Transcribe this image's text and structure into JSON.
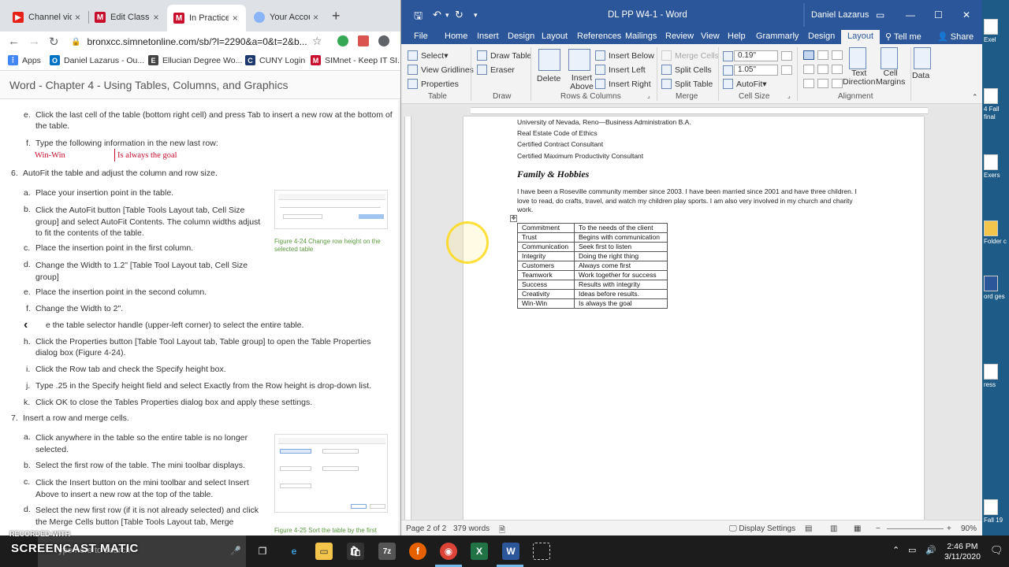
{
  "browser": {
    "tabs": [
      {
        "label": "Channel vid",
        "close": "×"
      },
      {
        "label": "Edit Class",
        "close": "×"
      },
      {
        "label": "In Practice",
        "close": "×"
      },
      {
        "label": "Your Accou",
        "close": "×"
      }
    ],
    "new_tab": "+",
    "url": "bronxcc.simnetonline.com/sb/?l=2290&a=0&t=2&b...",
    "bookmarks": [
      "Apps",
      "Daniel Lazarus - Ou...",
      "Ellucian Degree Wo...",
      "CUNY Login",
      "SIMnet - Keep IT SI..."
    ]
  },
  "simnet": {
    "title": "Word - Chapter 4 - Using Tables, Columns, and Graphics",
    "steps": [
      {
        "id": "e1",
        "letter": "e.",
        "text": "Click the last cell of the table (bottom right cell) and press Tab to insert a new row at the bottom of"
      },
      {
        "id": "e1b",
        "text": "the table."
      },
      {
        "id": "f1",
        "letter": "f.",
        "text": "Type the following information in the new last row:"
      },
      {
        "id": "ex1",
        "text": "Win-Win"
      },
      {
        "id": "ex2",
        "text": "Is always the goal"
      },
      {
        "id": "s6",
        "letter": "6.",
        "text": "AutoFit the table and adjust the column and row size."
      },
      {
        "id": "a6",
        "letter": "a.",
        "text": "Place your insertion point in the table."
      },
      {
        "id": "b6",
        "letter": "b.",
        "text": "Click the AutoFit button [Table Tools Layout tab, Cell Size group] and select AutoFit Contents. The column widths adjust to fit the contents of the table."
      },
      {
        "id": "c6",
        "letter": "c.",
        "text": "Place the insertion point in the first column."
      },
      {
        "id": "d6",
        "letter": "d.",
        "text": "Change the Width to 1.2\" [Table Tool Layout tab, Cell Size group]"
      },
      {
        "id": "e6",
        "letter": "e.",
        "text": "Place the insertion point in the second column."
      },
      {
        "id": "f6",
        "letter": "f.",
        "text": "Change the Width to 2\"."
      },
      {
        "id": "g6",
        "text": "e the table selector handle (upper-left corner) to select the entire table."
      },
      {
        "id": "h6",
        "letter": "h.",
        "text": "Click the Properties button [Table Tool Layout tab, Table group] to open the Table Properties"
      },
      {
        "id": "h6b",
        "text": "dialog box (Figure 4-24)."
      },
      {
        "id": "i6",
        "letter": "i.",
        "text": "Click the Row tab and check the Specify height box."
      },
      {
        "id": "j6",
        "letter": "j.",
        "text": "Type .25 in the Specify height field and select Exactly from the Row height is drop-down list."
      },
      {
        "id": "k6",
        "letter": "k.",
        "text": "Click OK to close the Tables Properties dialog box and apply these settings."
      },
      {
        "id": "s7",
        "letter": "7.",
        "text": "Insert a row and merge cells."
      },
      {
        "id": "a7",
        "letter": "a.",
        "text": "Click anywhere in the table so the entire table is no longer selected."
      },
      {
        "id": "b7",
        "letter": "b.",
        "text": "Select the first row of the table. The mini toolbar displays."
      },
      {
        "id": "c7",
        "letter": "c.",
        "text": "Click the Insert button on the mini toolbar and select Insert Above to insert a new row at the top of the table."
      },
      {
        "id": "d7",
        "letter": "d.",
        "text": "Select the new first row (if it is not already selected) and click the Merge Cells button [Table Tools Layout tab, Merge"
      }
    ],
    "figure_24_caption": "Figure 4-24 Change row height on the selected table",
    "figure_25_caption": "Figure 4-25 Sort the table by the first"
  },
  "word": {
    "doc_title": "DL PP W4-1  -  Word",
    "user": "Daniel Lazarus",
    "tabs": [
      "File",
      "Home",
      "Insert",
      "Design",
      "Layout",
      "References",
      "Mailings",
      "Review",
      "View",
      "Help",
      "Grammarly",
      "Design",
      "Layout",
      "Tell me",
      "Share"
    ],
    "ribbon": {
      "select": "Select",
      "view_gridlines": "View Gridlines",
      "properties": "Properties",
      "draw_table": "Draw Table",
      "eraser": "Eraser",
      "delete": "Delete",
      "insert_above": "Insert Above",
      "insert_below": "Insert Below",
      "insert_left": "Insert Left",
      "insert_right": "Insert Right",
      "merge_cells": "Merge Cells",
      "split_cells": "Split Cells",
      "split_table": "Split Table",
      "row_height": "0.19\"",
      "col_width": "1.05\"",
      "autofit": "AutoFit",
      "text_direction": "Text Direction",
      "cell_margins": "Cell Margins",
      "data": "Data",
      "groups": [
        "Table",
        "Draw",
        "Rows & Columns",
        "Merge",
        "Cell Size",
        "Alignment"
      ]
    },
    "document": {
      "lines": [
        "University of Nevada, Reno—Business Administration B.A.",
        "Real Estate Code of Ethics",
        "Certified Contract Consultant",
        "Certified Maximum Productivity Consultant"
      ],
      "heading": "Family & Hobbies",
      "paragraph": "I have been a Roseville community member since 2003. I have been married since 2001 and have three children. I love to read, do crafts, travel, and watch my children play sports. I am also very involved in my church and charity work.",
      "table": [
        [
          "Commitment",
          "To the needs of the client"
        ],
        [
          "Trust",
          "Begins with communication"
        ],
        [
          "Communication",
          "Seek first to listen"
        ],
        [
          "Integrity",
          "Doing the right thing"
        ],
        [
          "Customers",
          "Always come first"
        ],
        [
          "Teamwork",
          "Work together for success"
        ],
        [
          "Success",
          "Results with integrity"
        ],
        [
          "Creativity",
          "Ideas before results."
        ],
        [
          "Win-Win",
          "Is always the goal"
        ]
      ]
    },
    "status": {
      "page": "Page 2 of 2",
      "words": "379 words",
      "display_settings": "Display Settings",
      "zoom": "90%"
    }
  },
  "desktop": {
    "labels": [
      "Exel",
      "4 Fall final",
      "Exers",
      "Folder c",
      "ord ges",
      "ress",
      "Fall 19"
    ]
  },
  "taskbar": {
    "search_placeholder": "Type here to search",
    "time": "2:46 PM",
    "date": "3/11/2020"
  },
  "overlay": {
    "recorded": "RECORDED WITH",
    "brand": "SCREENCAST MATIC"
  },
  "colors": {
    "word_blue": "#2b579a",
    "simnet_red": "#c8102e",
    "figure_caption": "#5a9a3e"
  }
}
